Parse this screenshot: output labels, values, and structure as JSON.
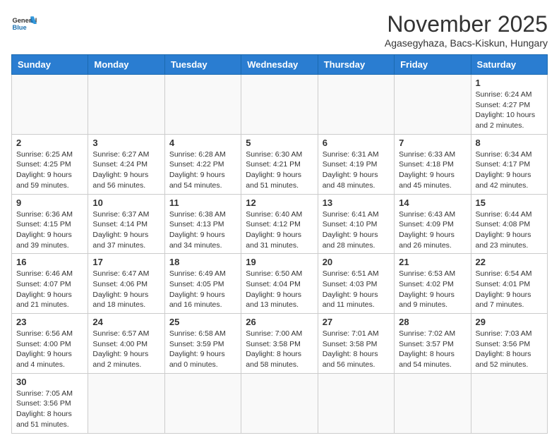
{
  "logo": {
    "general": "General",
    "blue": "Blue"
  },
  "header": {
    "month": "November 2025",
    "location": "Agasegyhaza, Bacs-Kiskun, Hungary"
  },
  "days_of_week": [
    "Sunday",
    "Monday",
    "Tuesday",
    "Wednesday",
    "Thursday",
    "Friday",
    "Saturday"
  ],
  "weeks": [
    [
      {
        "day": "",
        "info": ""
      },
      {
        "day": "",
        "info": ""
      },
      {
        "day": "",
        "info": ""
      },
      {
        "day": "",
        "info": ""
      },
      {
        "day": "",
        "info": ""
      },
      {
        "day": "",
        "info": ""
      },
      {
        "day": "1",
        "info": "Sunrise: 6:24 AM\nSunset: 4:27 PM\nDaylight: 10 hours and 2 minutes."
      }
    ],
    [
      {
        "day": "2",
        "info": "Sunrise: 6:25 AM\nSunset: 4:25 PM\nDaylight: 9 hours and 59 minutes."
      },
      {
        "day": "3",
        "info": "Sunrise: 6:27 AM\nSunset: 4:24 PM\nDaylight: 9 hours and 56 minutes."
      },
      {
        "day": "4",
        "info": "Sunrise: 6:28 AM\nSunset: 4:22 PM\nDaylight: 9 hours and 54 minutes."
      },
      {
        "day": "5",
        "info": "Sunrise: 6:30 AM\nSunset: 4:21 PM\nDaylight: 9 hours and 51 minutes."
      },
      {
        "day": "6",
        "info": "Sunrise: 6:31 AM\nSunset: 4:19 PM\nDaylight: 9 hours and 48 minutes."
      },
      {
        "day": "7",
        "info": "Sunrise: 6:33 AM\nSunset: 4:18 PM\nDaylight: 9 hours and 45 minutes."
      },
      {
        "day": "8",
        "info": "Sunrise: 6:34 AM\nSunset: 4:17 PM\nDaylight: 9 hours and 42 minutes."
      }
    ],
    [
      {
        "day": "9",
        "info": "Sunrise: 6:36 AM\nSunset: 4:15 PM\nDaylight: 9 hours and 39 minutes."
      },
      {
        "day": "10",
        "info": "Sunrise: 6:37 AM\nSunset: 4:14 PM\nDaylight: 9 hours and 37 minutes."
      },
      {
        "day": "11",
        "info": "Sunrise: 6:38 AM\nSunset: 4:13 PM\nDaylight: 9 hours and 34 minutes."
      },
      {
        "day": "12",
        "info": "Sunrise: 6:40 AM\nSunset: 4:12 PM\nDaylight: 9 hours and 31 minutes."
      },
      {
        "day": "13",
        "info": "Sunrise: 6:41 AM\nSunset: 4:10 PM\nDaylight: 9 hours and 28 minutes."
      },
      {
        "day": "14",
        "info": "Sunrise: 6:43 AM\nSunset: 4:09 PM\nDaylight: 9 hours and 26 minutes."
      },
      {
        "day": "15",
        "info": "Sunrise: 6:44 AM\nSunset: 4:08 PM\nDaylight: 9 hours and 23 minutes."
      }
    ],
    [
      {
        "day": "16",
        "info": "Sunrise: 6:46 AM\nSunset: 4:07 PM\nDaylight: 9 hours and 21 minutes."
      },
      {
        "day": "17",
        "info": "Sunrise: 6:47 AM\nSunset: 4:06 PM\nDaylight: 9 hours and 18 minutes."
      },
      {
        "day": "18",
        "info": "Sunrise: 6:49 AM\nSunset: 4:05 PM\nDaylight: 9 hours and 16 minutes."
      },
      {
        "day": "19",
        "info": "Sunrise: 6:50 AM\nSunset: 4:04 PM\nDaylight: 9 hours and 13 minutes."
      },
      {
        "day": "20",
        "info": "Sunrise: 6:51 AM\nSunset: 4:03 PM\nDaylight: 9 hours and 11 minutes."
      },
      {
        "day": "21",
        "info": "Sunrise: 6:53 AM\nSunset: 4:02 PM\nDaylight: 9 hours and 9 minutes."
      },
      {
        "day": "22",
        "info": "Sunrise: 6:54 AM\nSunset: 4:01 PM\nDaylight: 9 hours and 7 minutes."
      }
    ],
    [
      {
        "day": "23",
        "info": "Sunrise: 6:56 AM\nSunset: 4:00 PM\nDaylight: 9 hours and 4 minutes."
      },
      {
        "day": "24",
        "info": "Sunrise: 6:57 AM\nSunset: 4:00 PM\nDaylight: 9 hours and 2 minutes."
      },
      {
        "day": "25",
        "info": "Sunrise: 6:58 AM\nSunset: 3:59 PM\nDaylight: 9 hours and 0 minutes."
      },
      {
        "day": "26",
        "info": "Sunrise: 7:00 AM\nSunset: 3:58 PM\nDaylight: 8 hours and 58 minutes."
      },
      {
        "day": "27",
        "info": "Sunrise: 7:01 AM\nSunset: 3:58 PM\nDaylight: 8 hours and 56 minutes."
      },
      {
        "day": "28",
        "info": "Sunrise: 7:02 AM\nSunset: 3:57 PM\nDaylight: 8 hours and 54 minutes."
      },
      {
        "day": "29",
        "info": "Sunrise: 7:03 AM\nSunset: 3:56 PM\nDaylight: 8 hours and 52 minutes."
      }
    ],
    [
      {
        "day": "30",
        "info": "Sunrise: 7:05 AM\nSunset: 3:56 PM\nDaylight: 8 hours and 51 minutes."
      },
      {
        "day": "",
        "info": ""
      },
      {
        "day": "",
        "info": ""
      },
      {
        "day": "",
        "info": ""
      },
      {
        "day": "",
        "info": ""
      },
      {
        "day": "",
        "info": ""
      },
      {
        "day": "",
        "info": ""
      }
    ]
  ]
}
